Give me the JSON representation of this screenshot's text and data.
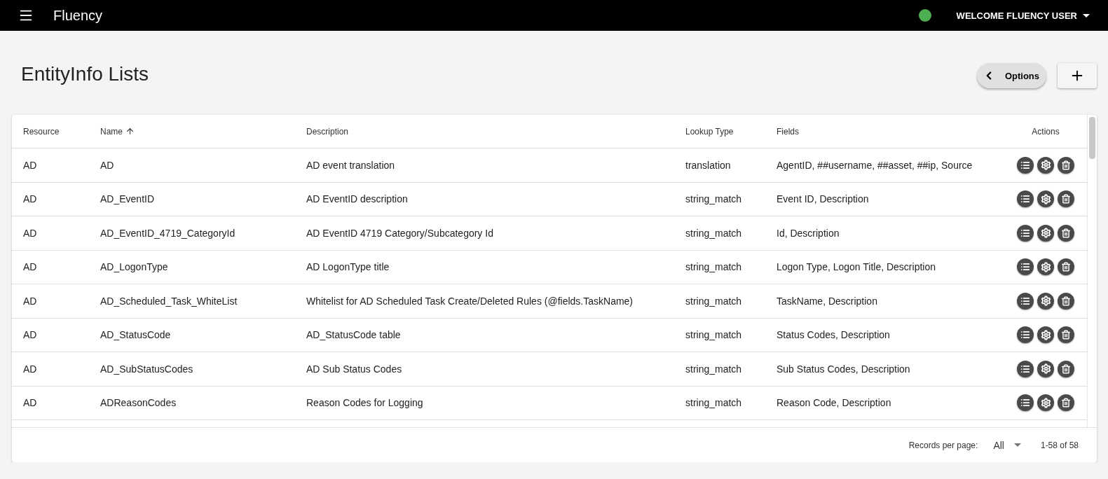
{
  "app_bar": {
    "title": "Fluency",
    "online": true,
    "user_label": "WELCOME FLUENCY USER"
  },
  "page": {
    "title": "EntityInfo Lists",
    "options_label": "Options"
  },
  "table": {
    "columns": [
      {
        "label": "Resource",
        "sorted": false
      },
      {
        "label": "Name",
        "sorted": true
      },
      {
        "label": "Description",
        "sorted": false
      },
      {
        "label": "Lookup Type",
        "sorted": false
      },
      {
        "label": "Fields",
        "sorted": false
      },
      {
        "label": "Actions",
        "sorted": false
      }
    ],
    "rows": [
      {
        "resource": "AD",
        "name": "AD",
        "description": "AD event translation",
        "lookup_type": "translation",
        "fields": "AgentID, ##username, ##asset, ##ip, Source"
      },
      {
        "resource": "AD",
        "name": "AD_EventID",
        "description": "AD EventID description",
        "lookup_type": "string_match",
        "fields": "Event ID, Description"
      },
      {
        "resource": "AD",
        "name": "AD_EventID_4719_CategoryId",
        "description": "AD EventID 4719 Category/Subcategory Id",
        "lookup_type": "string_match",
        "fields": "Id, Description"
      },
      {
        "resource": "AD",
        "name": "AD_LogonType",
        "description": "AD LogonType title",
        "lookup_type": "string_match",
        "fields": "Logon Type, Logon Title, Description"
      },
      {
        "resource": "AD",
        "name": "AD_Scheduled_Task_WhiteList",
        "description": "Whitelist for AD Scheduled Task Create/Deleted Rules (@fields.TaskName)",
        "lookup_type": "string_match",
        "fields": "TaskName, Description"
      },
      {
        "resource": "AD",
        "name": "AD_StatusCode",
        "description": "AD_StatusCode table",
        "lookup_type": "string_match",
        "fields": "Status Codes, Description"
      },
      {
        "resource": "AD",
        "name": "AD_SubStatusCodes",
        "description": "AD Sub Status Codes",
        "lookup_type": "string_match",
        "fields": "Sub Status Codes, Description"
      },
      {
        "resource": "AD",
        "name": "ADReasonCodes",
        "description": "Reason Codes for Logging",
        "lookup_type": "string_match",
        "fields": "Reason Code, Description"
      }
    ]
  },
  "footer": {
    "records_label": "Records per page:",
    "records_value": "All",
    "range": "1-58 of 58"
  }
}
